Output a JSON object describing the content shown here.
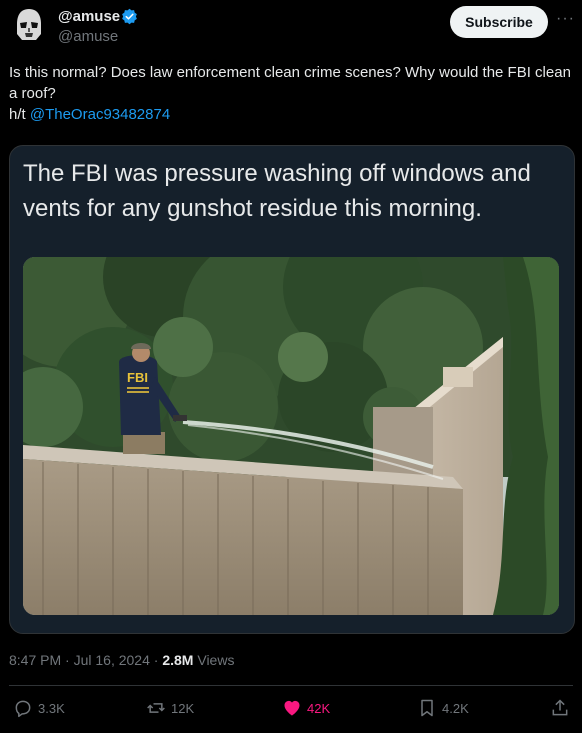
{
  "author": {
    "name": "@amuse",
    "handle": "@amuse",
    "subscribe_label": "Subscribe",
    "more_label": "···"
  },
  "tweet": {
    "text": "Is this normal? Does law enforcement clean crime scenes? Why would the FBI clean a roof?",
    "ht_prefix": "h/t ",
    "ht_mention": "@TheOrac93482874"
  },
  "quote": {
    "text": "The FBI was pressure washing off windows and vents for any gunshot residue this morning.",
    "vest_text": "FBI"
  },
  "meta": {
    "time": "8:47 PM",
    "sep1": " · ",
    "date": "Jul 16, 2024",
    "sep2": " · ",
    "views_count": "2.8M",
    "views_label": " Views"
  },
  "actions": {
    "replies": "3.3K",
    "reposts": "12K",
    "likes": "42K",
    "bookmarks": "4.2K"
  },
  "colors": {
    "accent": "#1d9bf0",
    "like": "#f91880",
    "background": "#000000"
  }
}
